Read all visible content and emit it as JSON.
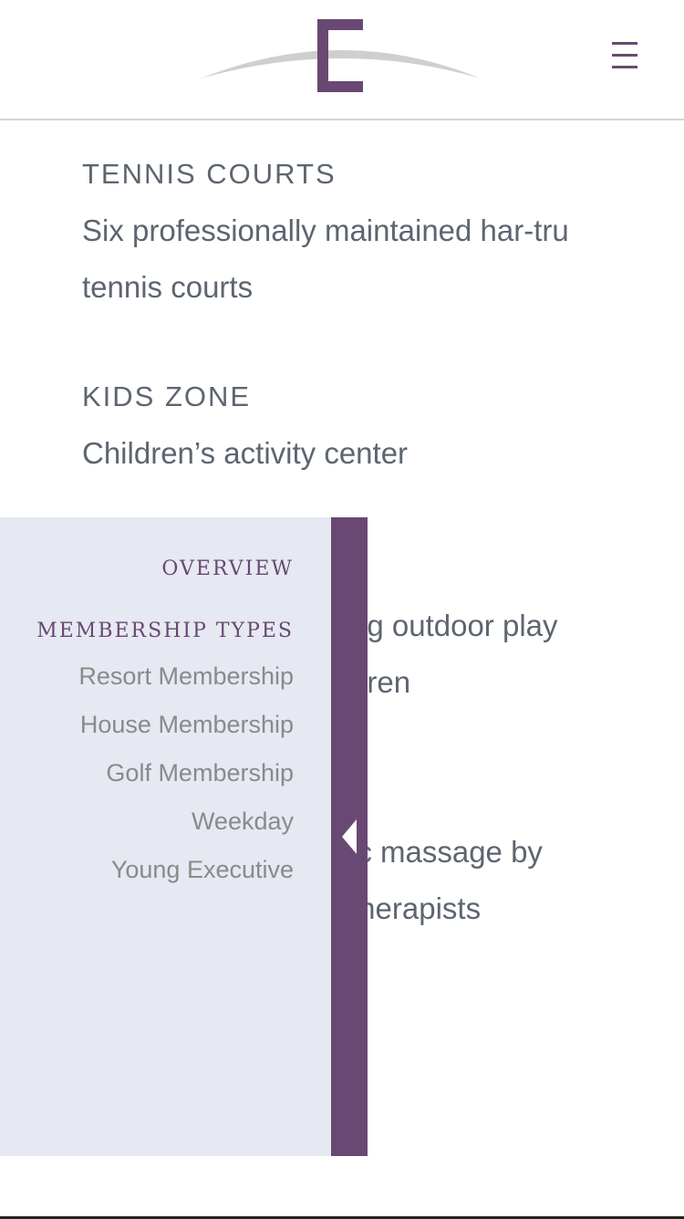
{
  "header": {
    "logo_icon": "club-e-logo",
    "menu_icon": "hamburger-menu-icon"
  },
  "amenities": [
    {
      "title": "TENNIS COURTS",
      "description": "Six professionally maintained har-tru tennis courts"
    },
    {
      "title": "KIDS ZONE",
      "description": "Children’s activity center"
    }
  ],
  "background_fragments": {
    "line1": "ng outdoor play",
    "line2": "dren",
    "line3": "ic massage by",
    "line4": "therapists"
  },
  "drawer": {
    "overview_label": "OVERVIEW",
    "membership_types_label": "MEMBERSHIP TYPES",
    "items": [
      {
        "label": "Resort Membership"
      },
      {
        "label": "House Membership"
      },
      {
        "label": "Golf Membership"
      },
      {
        "label": "Weekday"
      },
      {
        "label": "Young Executive"
      }
    ],
    "toggle_icon": "caret-left-icon"
  },
  "colors": {
    "accent": "#694873",
    "drawer_bg": "#e6e9f1",
    "text": "#5d6570",
    "muted_text": "#8a8a8a",
    "logo_swoosh": "#cfcfcf"
  }
}
